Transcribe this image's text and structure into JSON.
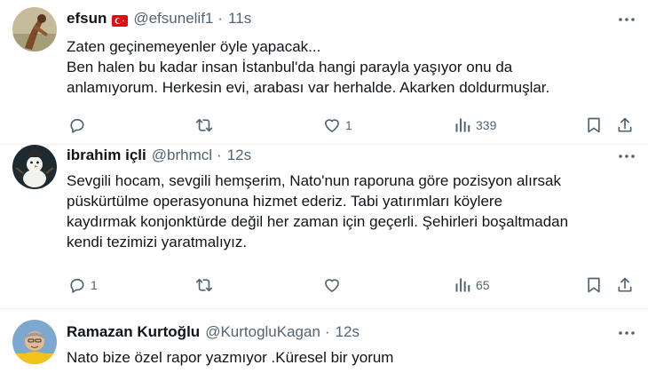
{
  "tweets": [
    {
      "name": "efsun",
      "handle": "@efsunelif1",
      "time": "11s",
      "lines": [
        "Zaten geçinemeyenler öyle yapacak...",
        "Ben halen bu kadar insan İstanbul'da hangi parayla yaşıyor onu da",
        "anlamıyorum. Herkesin evi, arabası var herhalde. Akarken doldurmuşlar."
      ],
      "replies": "",
      "reposts": "",
      "likes": "1",
      "views": "339"
    },
    {
      "name": "ibrahim içli",
      "handle": "@brhmcl",
      "time": "12s",
      "lines": [
        "Sevgili hocam, sevgili hemşerim, Nato'nun raporuna göre pozisyon alırsak",
        "püskürtülme operasyonuna hizmet ederiz. Tabi yatırımları köylere",
        "kaydırmak konjonktürde değil her zaman için geçerli. Şehirleri boşaltmadan",
        "kendi tezimizi yaratmalıyız."
      ],
      "replies": "1",
      "reposts": "",
      "likes": "",
      "views": "65"
    },
    {
      "name": "Ramazan Kurtoğlu",
      "handle": "@KurtogluKagan",
      "time": "12s",
      "lines": [
        "Nato bize özel rapor yazmıyor .Küresel bir yorum"
      ]
    }
  ],
  "separator": "·",
  "colors": {
    "text": "#0f1419",
    "secondary": "#536471",
    "divider": "#eff3f4",
    "flag_red": "#e30a17"
  },
  "icons": [
    "more-icon",
    "reply-icon",
    "repost-icon",
    "like-icon",
    "views-icon",
    "bookmark-icon",
    "share-icon",
    "turkey-flag-icon"
  ]
}
